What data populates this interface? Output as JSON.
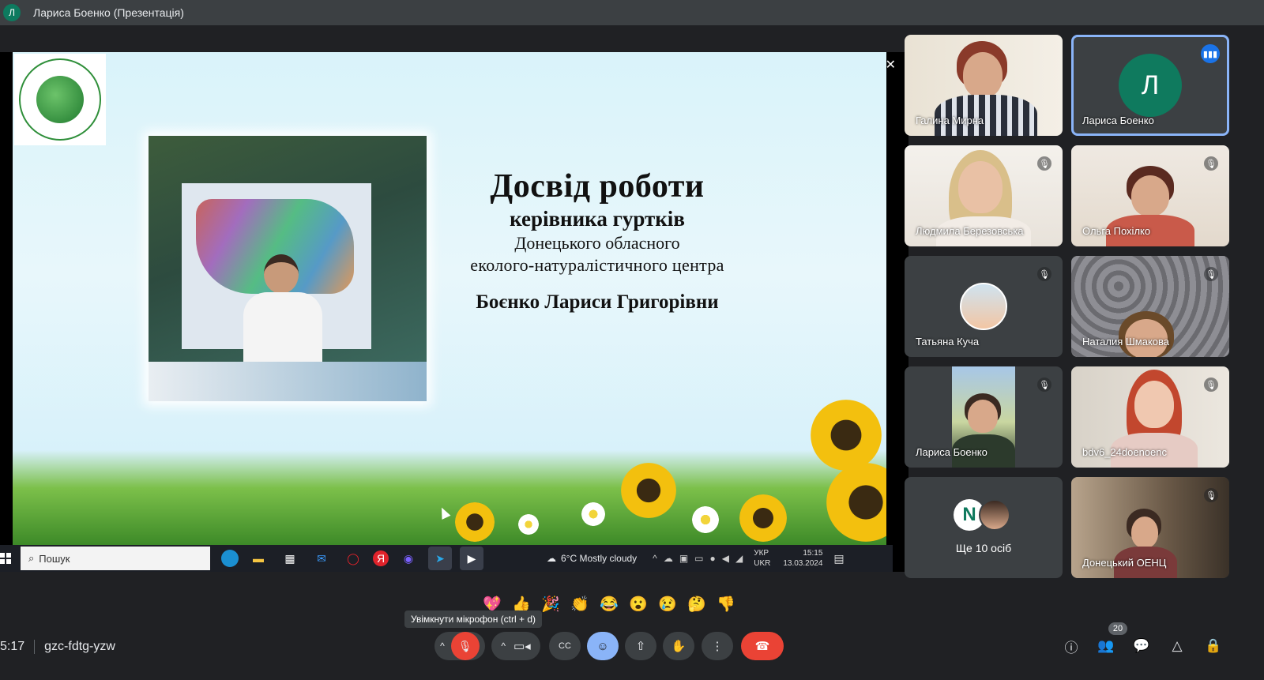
{
  "topbar": {
    "avatar_letter": "Л",
    "title": "Лариса Боенко (Презентація)"
  },
  "slide": {
    "close_icon": "✕",
    "title": "Досвід роботи",
    "subtitle": "керівника гуртків",
    "line3": "Донецького обласного",
    "line4": "еколого-натуралістичного центра",
    "author": "Боєнко Лариси Григорівни"
  },
  "taskbar": {
    "search_placeholder": "Пошук",
    "weather": "6°C  Mostly cloudy",
    "lang1": "УКР",
    "lang2": "UKR",
    "time": "15:15",
    "date": "13.03.2024"
  },
  "participants": [
    {
      "name": "Галина Мирна",
      "muted": false
    },
    {
      "name": "Лариса Боенко",
      "avatar_letter": "Л",
      "speaking": true
    },
    {
      "name": "Людмила Березовська",
      "muted": true
    },
    {
      "name": "Ольга Похілко",
      "muted": true
    },
    {
      "name": "Татьяна Куча",
      "muted": true
    },
    {
      "name": "Наталия Шмакова",
      "muted": true
    },
    {
      "name": "Лариса Боенко",
      "muted": true
    },
    {
      "name": "bdv6_24doenoenc",
      "muted": true
    },
    {
      "more_letter": "N",
      "label": "Ще 10 осіб"
    },
    {
      "name": "Донецький ОЕНЦ",
      "muted": true
    }
  ],
  "reactions": [
    "💖",
    "👍",
    "🎉",
    "👏",
    "😂",
    "😮",
    "😢",
    "🤔",
    "👎"
  ],
  "tooltip": "Увімкнути мікрофон (ctrl + d)",
  "meeting": {
    "time": "5:17",
    "code": "gzc-fdtg-yzw"
  },
  "people_count": "20",
  "colors": {
    "end_call": "#ea4335",
    "mic_off": "#ea4335",
    "emoji_active": "#8ab4f8",
    "accent_speaker": "#8ab4f8"
  }
}
